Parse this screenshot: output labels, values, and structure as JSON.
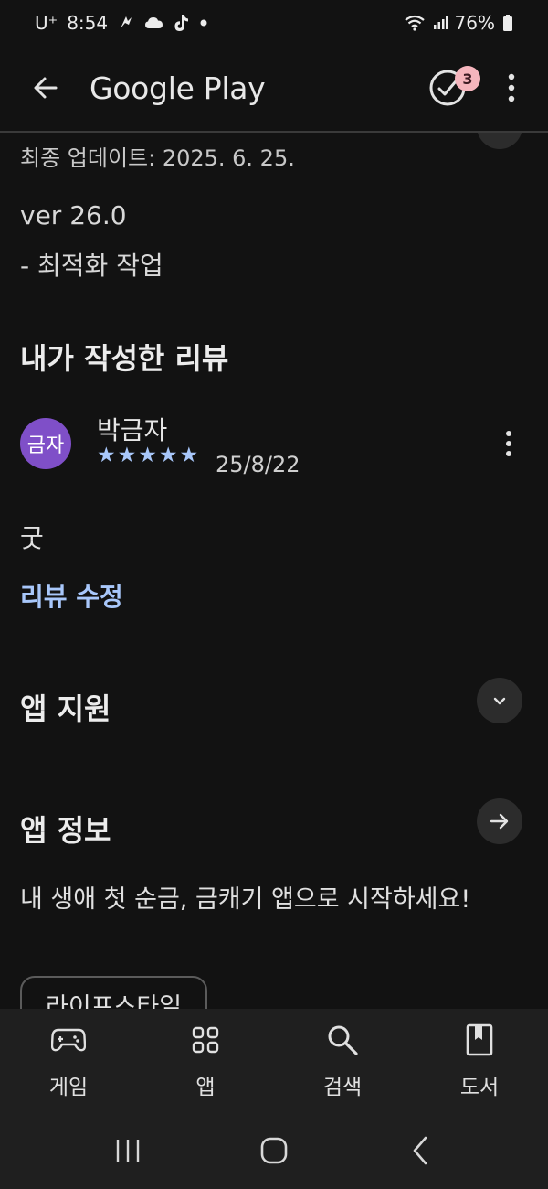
{
  "status_bar": {
    "carrier": "U⁺",
    "time": "8:54",
    "battery": "76%"
  },
  "app_bar": {
    "title": "Google Play",
    "updates_badge": "3"
  },
  "app_details": {
    "last_updated": "최종 업데이트: 2025. 6. 25.",
    "version": "ver 26.0",
    "changelog": "- 최적화 작업"
  },
  "my_review": {
    "section_title": "내가 작성한 리뷰",
    "avatar_text": "금자",
    "avatar_color": "#7f4fc8",
    "reviewer_name": "박금자",
    "rating": 5,
    "date": "25/8/22",
    "text": "굿",
    "edit_label": "리뷰 수정"
  },
  "app_support": {
    "title": "앱 지원"
  },
  "app_info": {
    "title": "앱 정보",
    "description": "내 생애 첫 순금, 금캐기 앱으로 시작하세요!",
    "category_chip": "라이프스타일"
  },
  "bottom_nav": {
    "items": [
      {
        "label": "게임",
        "icon": "gamepad-icon"
      },
      {
        "label": "앱",
        "icon": "apps-grid-icon"
      },
      {
        "label": "검색",
        "icon": "search-icon"
      },
      {
        "label": "도서",
        "icon": "book-icon"
      }
    ]
  },
  "colors": {
    "background": "#121212",
    "accent": "#a8c7fa",
    "badge": "#f5b5bd"
  }
}
